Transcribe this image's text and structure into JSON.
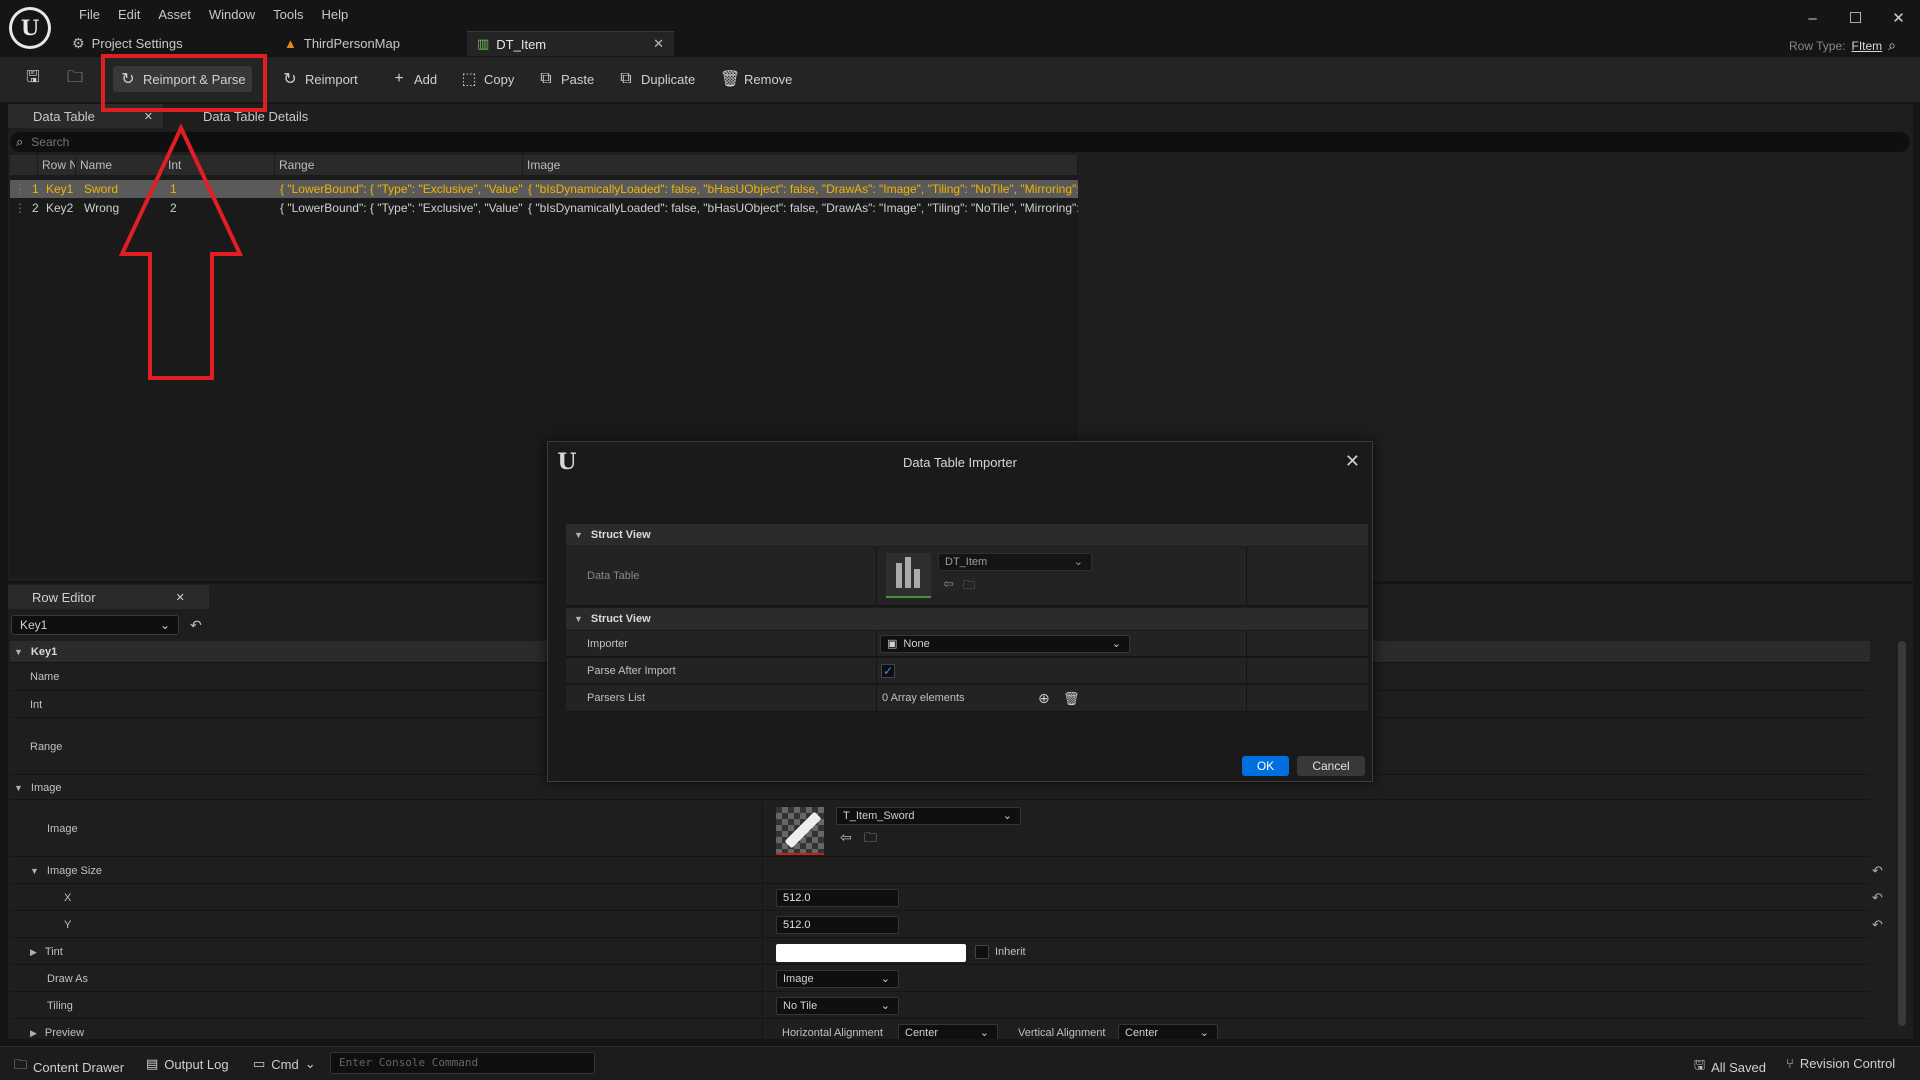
{
  "menu": [
    "File",
    "Edit",
    "Asset",
    "Window",
    "Tools",
    "Help"
  ],
  "doc_tabs": {
    "project_settings": "Project Settings",
    "third_person": "ThirdPersonMap",
    "dt_item": "DT_Item"
  },
  "row_type": {
    "label": "Row Type:",
    "value": "FItem"
  },
  "toolbar": {
    "reimport_parse": "Reimport & Parse",
    "reimport": "Reimport",
    "add": "Add",
    "copy": "Copy",
    "paste": "Paste",
    "duplicate": "Duplicate",
    "remove": "Remove"
  },
  "data_table": {
    "tab_label": "Data Table",
    "details_tab_label": "Data Table Details",
    "search_placeholder": "Search",
    "columns": [
      "Row N",
      "Name",
      "Int",
      "Range",
      "Image"
    ],
    "rows": [
      {
        "num": "1",
        "key": "Key1",
        "name": "Sword",
        "int": "1",
        "range": "{ \"LowerBound\": { \"Type\": \"Exclusive\", \"Value\"",
        "image": "{ \"bIsDynamicallyLoaded\": false, \"bHasUObject\": false, \"DrawAs\": \"Image\", \"Tiling\": \"NoTile\", \"Mirroring\":"
      },
      {
        "num": "2",
        "key": "Key2",
        "name": "Wrong",
        "int": "2",
        "range": "{ \"LowerBound\": { \"Type\": \"Exclusive\", \"Value\"",
        "image": "{ \"bIsDynamicallyLoaded\": false, \"bHasUObject\": false, \"DrawAs\": \"Image\", \"Tiling\": \"NoTile\", \"Mirroring\":"
      }
    ]
  },
  "row_editor": {
    "tab_label": "Row Editor",
    "selected_row": "Key1",
    "category_key": "Key1",
    "name_label": "Name",
    "int_label": "Int",
    "range_label": "Range",
    "image_category": "Image",
    "image_label": "Image",
    "image_asset": "T_Item_Sword",
    "image_size_label": "Image Size",
    "x_label": "X",
    "x_value": "512.0",
    "y_label": "Y",
    "y_value": "512.0",
    "tint_label": "Tint",
    "inherit_label": "Inherit",
    "draw_as_label": "Draw As",
    "draw_as_value": "Image",
    "tiling_label": "Tiling",
    "tiling_value": "No Tile",
    "preview_label": "Preview",
    "h_align_label": "Horizontal Alignment",
    "h_align_value": "Center",
    "v_align_label": "Vertical Alignment",
    "v_align_value": "Center"
  },
  "dialog": {
    "title": "Data Table Importer",
    "section1": "Struct View",
    "data_table_label": "Data Table",
    "data_table_value": "DT_Item",
    "section2": "Struct View",
    "importer_label": "Importer",
    "importer_value": "None",
    "parse_after_label": "Parse After Import",
    "parsers_label": "Parsers List",
    "parsers_value": "0 Array elements",
    "ok": "OK",
    "cancel": "Cancel"
  },
  "status": {
    "content_drawer": "Content Drawer",
    "output_log": "Output Log",
    "cmd": "Cmd",
    "console_placeholder": "Enter Console Command",
    "all_saved": "All Saved",
    "revision_control": "Revision Control"
  },
  "colors": {
    "accent_blue": "#0070e0",
    "selection_text": "#f0b400",
    "annotation_red": "#e01e24"
  }
}
